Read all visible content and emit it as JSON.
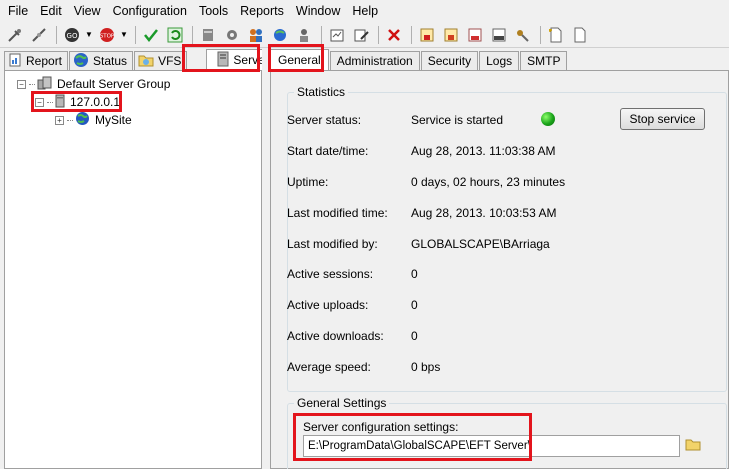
{
  "menu": [
    "File",
    "Edit",
    "View",
    "Configuration",
    "Tools",
    "Reports",
    "Window",
    "Help"
  ],
  "left_tabs": [
    {
      "label": "Report",
      "icon": "report-icon"
    },
    {
      "label": "Status",
      "icon": "globe-icon"
    },
    {
      "label": "VFS",
      "icon": "folder-icon"
    },
    {
      "label": "Server",
      "icon": "server-icon",
      "active": true
    }
  ],
  "tree": {
    "root": "Default Server Group",
    "server": "127.0.0.1",
    "site": "MySite"
  },
  "right_tabs": [
    {
      "label": "General",
      "active": true
    },
    {
      "label": "Administration"
    },
    {
      "label": "Security"
    },
    {
      "label": "Logs"
    },
    {
      "label": "SMTP"
    }
  ],
  "statistics": {
    "title": "Statistics",
    "rows": [
      {
        "label": "Server status:",
        "value": "Service is started"
      },
      {
        "label": "Start date/time:",
        "value": "Aug 28, 2013. 11:03:38 AM"
      },
      {
        "label": "Uptime:",
        "value": "0 days, 02 hours, 23 minutes"
      },
      {
        "label": "Last modified time:",
        "value": "Aug 28, 2013. 10:03:53 AM"
      },
      {
        "label": "Last modified by:",
        "value": "GLOBALSCAPE\\BArriaga"
      },
      {
        "label": "Active sessions:",
        "value": "0"
      },
      {
        "label": "Active uploads:",
        "value": "0"
      },
      {
        "label": "Active downloads:",
        "value": "0"
      },
      {
        "label": "Average speed:",
        "value": "0 bps"
      }
    ],
    "status_color": "#1aa31a",
    "stop_button": "Stop service"
  },
  "general_settings": {
    "title": "General Settings",
    "config_label": "Server configuration settings:",
    "config_path": "E:\\ProgramData\\GlobalSCAPE\\EFT Server\\"
  },
  "highlight_color": "#e3141c"
}
